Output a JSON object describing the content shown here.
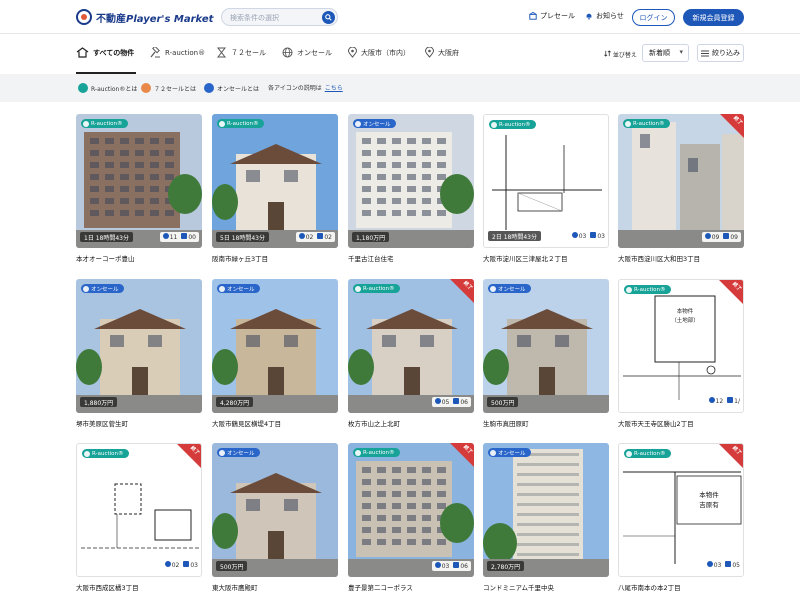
{
  "header": {
    "logo_text_1": "不動産",
    "logo_text_2": "Player's Market",
    "search_placeholder": "検索条件の選択",
    "link_presale": "プレセール",
    "link_notice": "お知らせ",
    "login": "ログイン",
    "register": "新規会員登録"
  },
  "categories": {
    "all": "すべての物件",
    "rauction": "R-auction®",
    "sale72": "７２セール",
    "online": "オンセール",
    "osaka_city": "大阪市（市内）",
    "osaka_pref": "大阪府"
  },
  "sort": {
    "label": "並び替え",
    "selected": "新着順",
    "filter": "絞り込み"
  },
  "infobar": {
    "rauction": "R-auction®とは",
    "sale72": "７２セールとは",
    "online": "オンセールとは",
    "icon_desc": "各アイコンの説明は",
    "icon_link": "こちら"
  },
  "colors": {
    "primary": "#1d57b8",
    "auction": "#17a398",
    "online": "#2a66c9",
    "sold": "#d63b3b"
  },
  "listings": [
    {
      "title": "本才オーコーポ豊山",
      "badge": "R-auction®",
      "type": "auction",
      "info": "1日 18時間43分",
      "c1": "11",
      "c2": "00",
      "ribbon": ""
    },
    {
      "title": "阪南市緑ヶ丘3丁目",
      "badge": "R-auction®",
      "type": "auction",
      "info": "5日 18時間43分",
      "c1": "02",
      "c2": "02",
      "ribbon": ""
    },
    {
      "title": "千里古江台住宅",
      "badge": "オンセール",
      "type": "online",
      "info": "1,180万円",
      "c1": "",
      "c2": "",
      "ribbon": ""
    },
    {
      "title": "大阪市淀川区三津屋北２丁目",
      "badge": "R-auction®",
      "type": "auction",
      "info": "2日 18時間43分",
      "c1": "03",
      "c2": "03",
      "ribbon": ""
    },
    {
      "title": "大阪市西淀川区大和田3丁目",
      "badge": "R-auction®",
      "type": "auction",
      "info": "",
      "c1": "09",
      "c2": "09",
      "ribbon": "終了"
    },
    {
      "title": "堺市美原区菅生町",
      "badge": "オンセール",
      "type": "online",
      "info": "1,880万円",
      "c1": "",
      "c2": "",
      "ribbon": ""
    },
    {
      "title": "大阪市鶴見区横堤4丁目",
      "badge": "オンセール",
      "type": "online",
      "info": "4,280万円",
      "c1": "",
      "c2": "",
      "ribbon": ""
    },
    {
      "title": "枚方市山之上北町",
      "badge": "R-auction®",
      "type": "auction",
      "info": "",
      "c1": "05",
      "c2": "06",
      "ribbon": "終了"
    },
    {
      "title": "生駒市真田原町",
      "badge": "オンセール",
      "type": "online",
      "info": "500万円",
      "c1": "",
      "c2": "",
      "ribbon": ""
    },
    {
      "title": "大阪市天王寺区勝山2丁目",
      "badge": "R-auction®",
      "type": "auction",
      "info": "",
      "c1": "12",
      "c2": "1/",
      "ribbon": "終了"
    },
    {
      "title": "大阪市西成区橘3丁目",
      "badge": "R-auction®",
      "type": "auction",
      "info": "",
      "c1": "02",
      "c2": "03",
      "ribbon": "終了"
    },
    {
      "title": "東大阪市鷹殿町",
      "badge": "オンセール",
      "type": "online",
      "info": "500万円",
      "c1": "",
      "c2": "",
      "ribbon": ""
    },
    {
      "title": "豊子景第二コーポラス",
      "badge": "R-auction®",
      "type": "auction",
      "info": "",
      "c1": "03",
      "c2": "06",
      "ribbon": "終了"
    },
    {
      "title": "コンドミニアム千里中央",
      "badge": "オンセール",
      "type": "online",
      "info": "2,780万円",
      "c1": "",
      "c2": "",
      "ribbon": ""
    },
    {
      "title": "八尾市南本の本2丁目",
      "badge": "R-auction®",
      "type": "auction",
      "info": "",
      "c1": "03",
      "c2": "05",
      "ribbon": "終了"
    }
  ],
  "drawing_labels": {
    "card10_a": "本物件",
    "card10_b": "（土地部）",
    "card15_a": "本物件",
    "card15_b": "吉原有"
  }
}
